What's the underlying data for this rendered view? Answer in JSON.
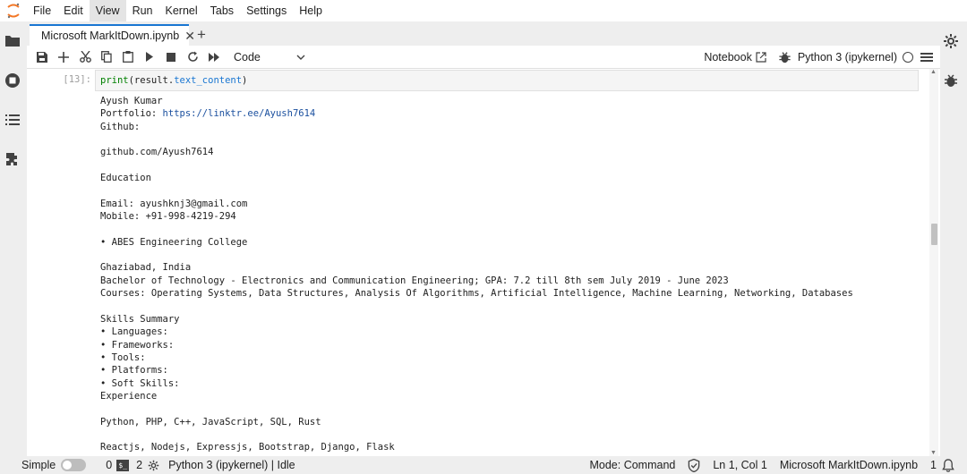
{
  "menu": {
    "items": [
      "File",
      "Edit",
      "View",
      "Run",
      "Kernel",
      "Tabs",
      "Settings",
      "Help"
    ],
    "active": "View"
  },
  "tab": {
    "label": "Microsoft MarkItDown.ipynb",
    "close": "✕",
    "add": "+"
  },
  "toolbar": {
    "cell_type": "Code",
    "notebook_label": "Notebook",
    "kernel_name": "Python 3 (ipykernel)"
  },
  "cell": {
    "prompt": "[13]:",
    "code_fn": "print",
    "code_open": "(result.",
    "code_attr": "text_content",
    "code_close": ")"
  },
  "output": {
    "lines": [
      "Ayush Kumar",
      "Portfolio: |https://linktr.ee/Ayush7614",
      "Github:",
      "",
      "github.com/Ayush7614",
      "",
      "Education",
      "",
      "Email: ayushknj3@gmail.com",
      "Mobile: +91-998-4219-294",
      "",
      "• ABES Engineering College",
      "",
      "Ghaziabad, India",
      "Bachelor of Technology - Electronics and Communication Engineering; GPA: 7.2 till 8th sem July 2019 - June 2023",
      "Courses: Operating Systems, Data Structures, Analysis Of Algorithms, Artificial Intelligence, Machine Learning, Networking, Databases",
      "",
      "Skills Summary",
      "• Languages:",
      "• Frameworks:",
      "• Tools:",
      "• Platforms:",
      "• Soft Skills:",
      "Experience",
      "",
      "Python, PHP, C++, JavaScript, SQL, Rust",
      "",
      "Reactjs, Nodejs, Expressjs, Bootstrap, Django, Flask"
    ]
  },
  "scroll": {
    "position": 0.42
  },
  "statusbar": {
    "simple": "Simple",
    "terminals": "0",
    "terminal_glyph": "$_",
    "kernels": "2",
    "kernel_status": "Python 3 (ipykernel) | Idle",
    "mode": "Mode: Command",
    "cursor": "Ln 1, Col 1",
    "file": "Microsoft MarkItDown.ipynb",
    "notifications": "1"
  },
  "colors": {
    "accent": "#1976d2",
    "toolbar_bg": "#ffffff",
    "chrome_bg": "#eeeeee",
    "link": "#1a4f9e",
    "code_fn": "#008000",
    "code_attr": "#1976d2"
  }
}
